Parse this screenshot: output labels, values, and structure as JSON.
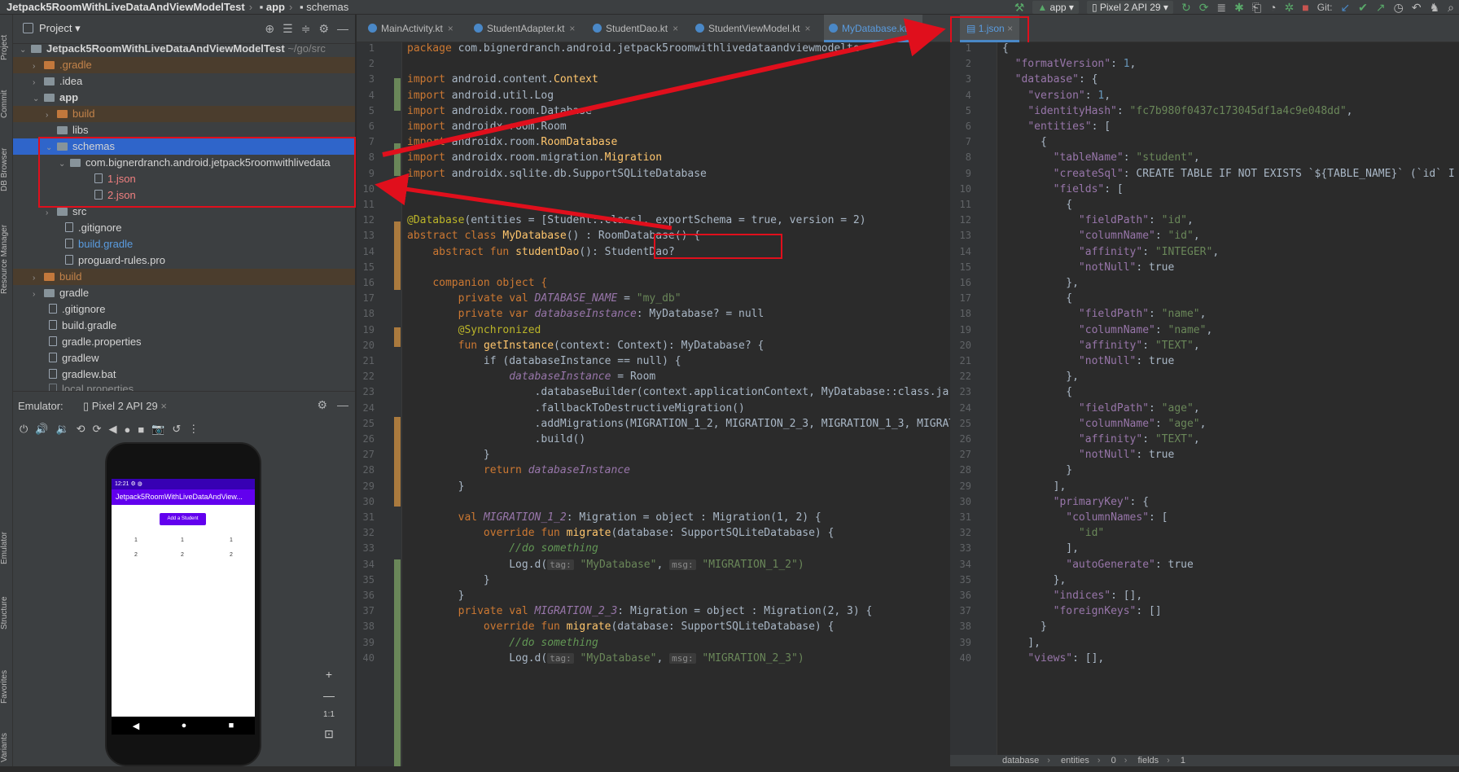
{
  "window": {
    "crumbs": [
      "Jetpack5RoomWithLiveDataAndViewModelTest",
      "app",
      "schemas"
    ]
  },
  "toolbar": {
    "app_config": "app",
    "device": "Pixel 2 API 29",
    "git_label": "Git:"
  },
  "side_strip": {
    "labels": [
      "Project",
      "Commit",
      "DB Browser",
      "Resource Manager",
      "Emulator",
      "Structure",
      "Favorites",
      "Variants"
    ]
  },
  "project_panel": {
    "title": "Project",
    "tree": [
      {
        "label": "Jetpack5RoomWithLiveDataAndViewModelTest",
        "suffix": "~/go/src"
      },
      {
        "label": ".gradle"
      },
      {
        "label": ".idea"
      },
      {
        "label": "app"
      },
      {
        "label": "build"
      },
      {
        "label": "libs"
      },
      {
        "label": "schemas"
      },
      {
        "label": "com.bignerdranch.android.jetpack5roomwithlivedata"
      },
      {
        "label": "1.json"
      },
      {
        "label": "2.json"
      },
      {
        "label": "src"
      },
      {
        "label": ".gitignore"
      },
      {
        "label": "build.gradle"
      },
      {
        "label": "proguard-rules.pro"
      },
      {
        "label": "build"
      },
      {
        "label": "gradle"
      },
      {
        "label": ".gitignore"
      },
      {
        "label": "build.gradle"
      },
      {
        "label": "gradle.properties"
      },
      {
        "label": "gradlew"
      },
      {
        "label": "gradlew.bat"
      },
      {
        "label": "local.properties"
      }
    ]
  },
  "emulator": {
    "title": "Emulator:",
    "device_tab": "Pixel 2 API 29",
    "phone": {
      "app_title": "Jetpack5RoomWithLiveDataAndView...",
      "button": "Add a Student",
      "rows": [
        [
          "1",
          "1",
          "1"
        ],
        [
          "2",
          "2",
          "2"
        ]
      ],
      "zoom_label": "1:1"
    }
  },
  "editor": {
    "tabs": [
      "MainActivity.kt",
      "StudentAdapter.kt",
      "StudentDao.kt",
      "StudentViewModel.kt",
      "MyDatabase.kt"
    ],
    "active_tab": "MyDatabase.kt",
    "line_numbers": [
      "1",
      "2",
      "3",
      "4",
      "5",
      "6",
      "7",
      "8",
      "9",
      "10",
      "11",
      "12",
      "13",
      "14",
      "15",
      "16",
      "17",
      "18",
      "19",
      "20",
      "21",
      "22",
      "23",
      "24",
      "25",
      "26",
      "27",
      "28",
      "29",
      "30",
      "31",
      "32",
      "33",
      "34",
      "35",
      "36",
      "37",
      "38",
      "39",
      "40"
    ],
    "lines": {
      "l1": "package com.bignerdranch.android.jetpack5roomwithlivedataandviewmodelte",
      "l3": "android.content.Context",
      "l4": "android.util.Log",
      "l5": "androidx.room.Database",
      "l6": "androidx.room.Room",
      "l7": "androidx.room.RoomDatabase",
      "l8": "androidx.room.migration.Migration",
      "l9": "androidx.sqlite.db.SupportSQLiteDatabase",
      "l12_a": "@Database",
      "l12_b": "(entities = [Student::class], ",
      "l12_c": "exportSchema = true",
      "l12_d": ", version = 2)",
      "l13_name": "MyDatabase",
      "l13_rest": "() : RoomDatabase() {",
      "l14_fn": "studentDao",
      "l14_rest": "(): StudentDao?",
      "l17_name": "DATABASE_NAME",
      "l17_val": "\"my_db\"",
      "l18_name": "databaseInstance",
      "l18_rest": ": MyDatabase? = null",
      "l19": "@Synchronized",
      "l20_fn": "getInstance",
      "l20_rest": "(context: Context): MyDatabase? {",
      "l21": "if (databaseInstance == null) {",
      "l22": "databaseInstance = Room",
      "l23": ".databaseBuilder(context.applicationContext, MyDatabase::class.ja",
      "l24": ".fallbackToDestructiveMigration()",
      "l25": ".addMigrations(MIGRATION_1_2, MIGRATION_2_3, MIGRATION_1_3, MIGRAT",
      "l26": ".build()",
      "l27": "}",
      "l28": "return databaseInstance",
      "l29": "}",
      "l31_name": "MIGRATION_1_2",
      "l31_rest": ": Migration = object : Migration(1, 2) {",
      "l32": "override fun migrate(database: SupportSQLiteDatabase) {",
      "l33": "//do something",
      "l34_tag": "tag:",
      "l34_tagv": "\"MyDatabase\"",
      "l34_msg": "msg:",
      "l34_msgv": "\"MIGRATION_1_2\")",
      "l35": "}",
      "l36": "}",
      "l37_name": "MIGRATION_2_3",
      "l37_rest": ": Migration = object : Migration(2, 3) {",
      "l38": "override fun migrate(database: SupportSQLiteDatabase) {",
      "l39": "//do something",
      "l40_msgv": "\"MIGRATION_2_3\")",
      "kw_import": "import",
      "kw_abstract_class": "abstract class",
      "kw_abstract_fun": "abstract fun",
      "kw_companion": "companion object {",
      "kw_private_val": "private val",
      "kw_private_var": "private var",
      "kw_fun": "fun",
      "kw_val": "val",
      "log_d": "Log.d(",
      "eq": " = "
    }
  },
  "json_panel": {
    "tab": "1.json",
    "line_numbers": [
      "1",
      "2",
      "3",
      "4",
      "5",
      "6",
      "7",
      "8",
      "9",
      "10",
      "11",
      "12",
      "13",
      "14",
      "15",
      "16",
      "17",
      "18",
      "19",
      "20",
      "21",
      "22",
      "23",
      "24",
      "25",
      "26",
      "27",
      "28",
      "29",
      "30",
      "31",
      "32",
      "33",
      "34",
      "35",
      "36",
      "37",
      "38",
      "39",
      "40"
    ],
    "lines": [
      "{",
      "  \"formatVersion\": 1,",
      "  \"database\": {",
      "    \"version\": 1,",
      "    \"identityHash\": \"fc7b980f0437c173045df1a4c9e048dd\",",
      "    \"entities\": [",
      "      {",
      "        \"tableName\": \"student\",",
      "        \"createSql\": \"CREATE TABLE IF NOT EXISTS `${TABLE_NAME}` (`id` I",
      "        \"fields\": [",
      "          {",
      "            \"fieldPath\": \"id\",",
      "            \"columnName\": \"id\",",
      "            \"affinity\": \"INTEGER\",",
      "            \"notNull\": true",
      "          },",
      "          {",
      "            \"fieldPath\": \"name\",",
      "            \"columnName\": \"name\",",
      "            \"affinity\": \"TEXT\",",
      "            \"notNull\": true",
      "          },",
      "          {",
      "            \"fieldPath\": \"age\",",
      "            \"columnName\": \"age\",",
      "            \"affinity\": \"TEXT\",",
      "            \"notNull\": true",
      "          }",
      "        ],",
      "        \"primaryKey\": {",
      "          \"columnNames\": [",
      "            \"id\"",
      "          ],",
      "          \"autoGenerate\": true",
      "        },",
      "        \"indices\": [],",
      "        \"foreignKeys\": []",
      "      }",
      "    ],",
      "    \"views\": [],"
    ],
    "status_path": [
      "database",
      "entities",
      "0",
      "fields",
      "1"
    ]
  },
  "colors": {
    "annotation_red": "#e00f1c",
    "selection_blue": "#2f65ca",
    "app_purple": "#6200ee"
  }
}
